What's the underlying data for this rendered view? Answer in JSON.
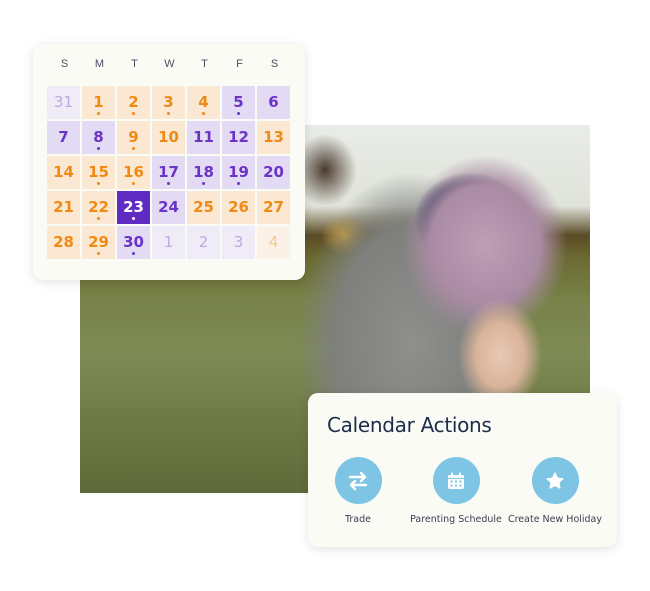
{
  "calendar": {
    "weekdays": [
      "S",
      "M",
      "T",
      "W",
      "T",
      "F",
      "S"
    ],
    "days": [
      {
        "label": "31",
        "style": "faded-purple",
        "dot": false
      },
      {
        "label": "1",
        "style": "orange",
        "dot": true
      },
      {
        "label": "2",
        "style": "orange",
        "dot": true
      },
      {
        "label": "3",
        "style": "orange",
        "dot": true
      },
      {
        "label": "4",
        "style": "orange",
        "dot": true
      },
      {
        "label": "5",
        "style": "purple",
        "dot": true
      },
      {
        "label": "6",
        "style": "purple",
        "dot": false
      },
      {
        "label": "7",
        "style": "purple",
        "dot": false
      },
      {
        "label": "8",
        "style": "purple",
        "dot": true
      },
      {
        "label": "9",
        "style": "orange",
        "dot": true
      },
      {
        "label": "10",
        "style": "orange",
        "dot": false
      },
      {
        "label": "11",
        "style": "purple",
        "dot": false
      },
      {
        "label": "12",
        "style": "purple",
        "dot": false
      },
      {
        "label": "13",
        "style": "orange",
        "dot": false
      },
      {
        "label": "14",
        "style": "orange",
        "dot": false
      },
      {
        "label": "15",
        "style": "orange",
        "dot": true
      },
      {
        "label": "16",
        "style": "orange",
        "dot": true
      },
      {
        "label": "17",
        "style": "purple",
        "dot": true
      },
      {
        "label": "18",
        "style": "purple",
        "dot": true
      },
      {
        "label": "19",
        "style": "purple",
        "dot": true
      },
      {
        "label": "20",
        "style": "purple",
        "dot": false
      },
      {
        "label": "21",
        "style": "orange",
        "dot": false
      },
      {
        "label": "22",
        "style": "orange",
        "dot": true
      },
      {
        "label": "23",
        "style": "selected",
        "dot": true
      },
      {
        "label": "24",
        "style": "purple",
        "dot": false
      },
      {
        "label": "25",
        "style": "orange",
        "dot": false
      },
      {
        "label": "26",
        "style": "orange",
        "dot": false
      },
      {
        "label": "27",
        "style": "orange",
        "dot": false
      },
      {
        "label": "28",
        "style": "orange",
        "dot": false
      },
      {
        "label": "29",
        "style": "orange",
        "dot": true
      },
      {
        "label": "30",
        "style": "purple",
        "dot": true
      },
      {
        "label": "1",
        "style": "faded-purple",
        "dot": false
      },
      {
        "label": "2",
        "style": "faded-purple",
        "dot": false
      },
      {
        "label": "3",
        "style": "faded-purple",
        "dot": false
      },
      {
        "label": "4",
        "style": "faded-orange",
        "dot": false
      }
    ],
    "selected_day": "23"
  },
  "photo": {
    "description": "Father lifting laughing child upside down in a grassy field"
  },
  "actions": {
    "title": "Calendar Actions",
    "items": [
      {
        "label": "Trade",
        "icon": "swap-arrows-icon"
      },
      {
        "label": "Parenting Schedule",
        "icon": "calendar-icon"
      },
      {
        "label": "Create New Holiday",
        "icon": "star-icon"
      }
    ]
  },
  "colors": {
    "orange": "#f08a14",
    "purple": "#6a34c6",
    "selected": "#5f2bc2",
    "action_circle": "#7ec4e4",
    "title_navy": "#1d2b4c"
  }
}
